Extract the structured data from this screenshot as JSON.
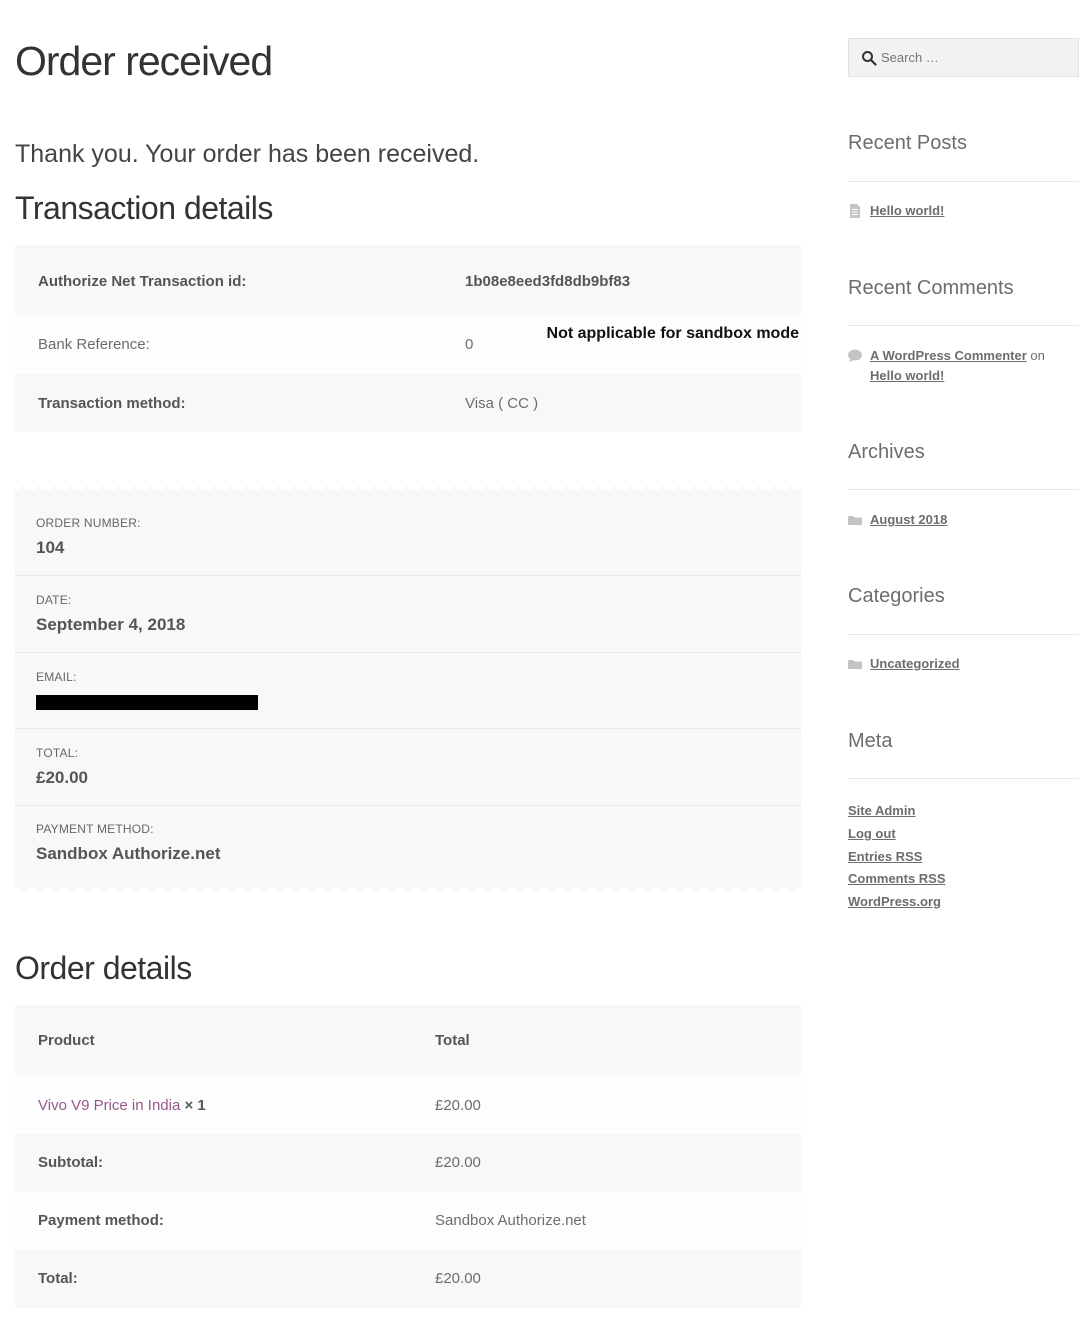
{
  "page": {
    "title": "Order received",
    "thankyou": "Thank you. Your order has been received."
  },
  "transaction": {
    "heading": "Transaction details",
    "sandbox_note": "Not applicable for sandbox mode",
    "rows": [
      {
        "label": "Authorize Net Transaction id:",
        "value": "1b08e8eed3fd8db9bf83"
      },
      {
        "label": "Bank Reference:",
        "value": "0"
      },
      {
        "label": "Transaction method:",
        "value": "Visa ( CC )"
      }
    ]
  },
  "overview": {
    "items": [
      {
        "label": "ORDER NUMBER:",
        "value": "104"
      },
      {
        "label": "DATE:",
        "value": "September 4, 2018"
      },
      {
        "label": "EMAIL:",
        "value": ""
      },
      {
        "label": "TOTAL:",
        "value": "£20.00"
      },
      {
        "label": "PAYMENT METHOD:",
        "value": "Sandbox Authorize.net"
      }
    ]
  },
  "order_details": {
    "heading": "Order details",
    "header": {
      "product": "Product",
      "total": "Total"
    },
    "product": {
      "name": "Vivo V9 Price in India",
      "qty": "× 1",
      "total": "£20.00"
    },
    "summary": [
      {
        "label": "Subtotal:",
        "value": "£20.00"
      },
      {
        "label": "Payment method:",
        "value": "Sandbox Authorize.net"
      },
      {
        "label": "Total:",
        "value": "£20.00"
      }
    ]
  },
  "sidebar": {
    "search_placeholder": "Search …",
    "recent_posts": {
      "title": "Recent Posts",
      "items": [
        "Hello world!"
      ]
    },
    "recent_comments": {
      "title": "Recent Comments",
      "author": "A WordPress Commenter",
      "on": "on",
      "post": "Hello world!"
    },
    "archives": {
      "title": "Archives",
      "items": [
        "August 2018"
      ]
    },
    "categories": {
      "title": "Categories",
      "items": [
        "Uncategorized"
      ]
    },
    "meta": {
      "title": "Meta",
      "items": [
        "Site Admin",
        "Log out",
        "Entries RSS",
        "Comments RSS",
        "WordPress.org"
      ]
    }
  }
}
